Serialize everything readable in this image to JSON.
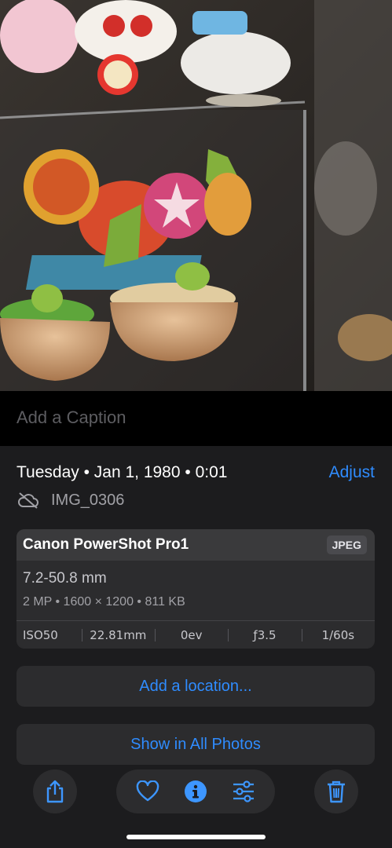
{
  "caption": {
    "placeholder": "Add a Caption"
  },
  "info": {
    "date": "Tuesday • Jan 1, 1980 • 0:01",
    "adjust_label": "Adjust",
    "filename": "IMG_0306"
  },
  "camera": {
    "model": "Canon PowerShot Pro1",
    "format": "JPEG",
    "lens": "7.2-50.8 mm",
    "specs": "2 MP • 1600 × 1200 • 811 KB",
    "exif": {
      "iso": "ISO50",
      "focal_length": "22.81mm",
      "exposure": "0ev",
      "aperture": "ƒ3.5",
      "shutter": "1/60s"
    }
  },
  "actions": {
    "add_location": "Add a location...",
    "show_all": "Show in All Photos"
  },
  "toolbar": {
    "icons": [
      "share-icon",
      "heart-icon",
      "info-icon",
      "adjust-sliders-icon",
      "trash-icon"
    ]
  },
  "colors": {
    "accent": "#2f8cff",
    "background": "#1c1c1e",
    "card": "#2c2c2e"
  }
}
